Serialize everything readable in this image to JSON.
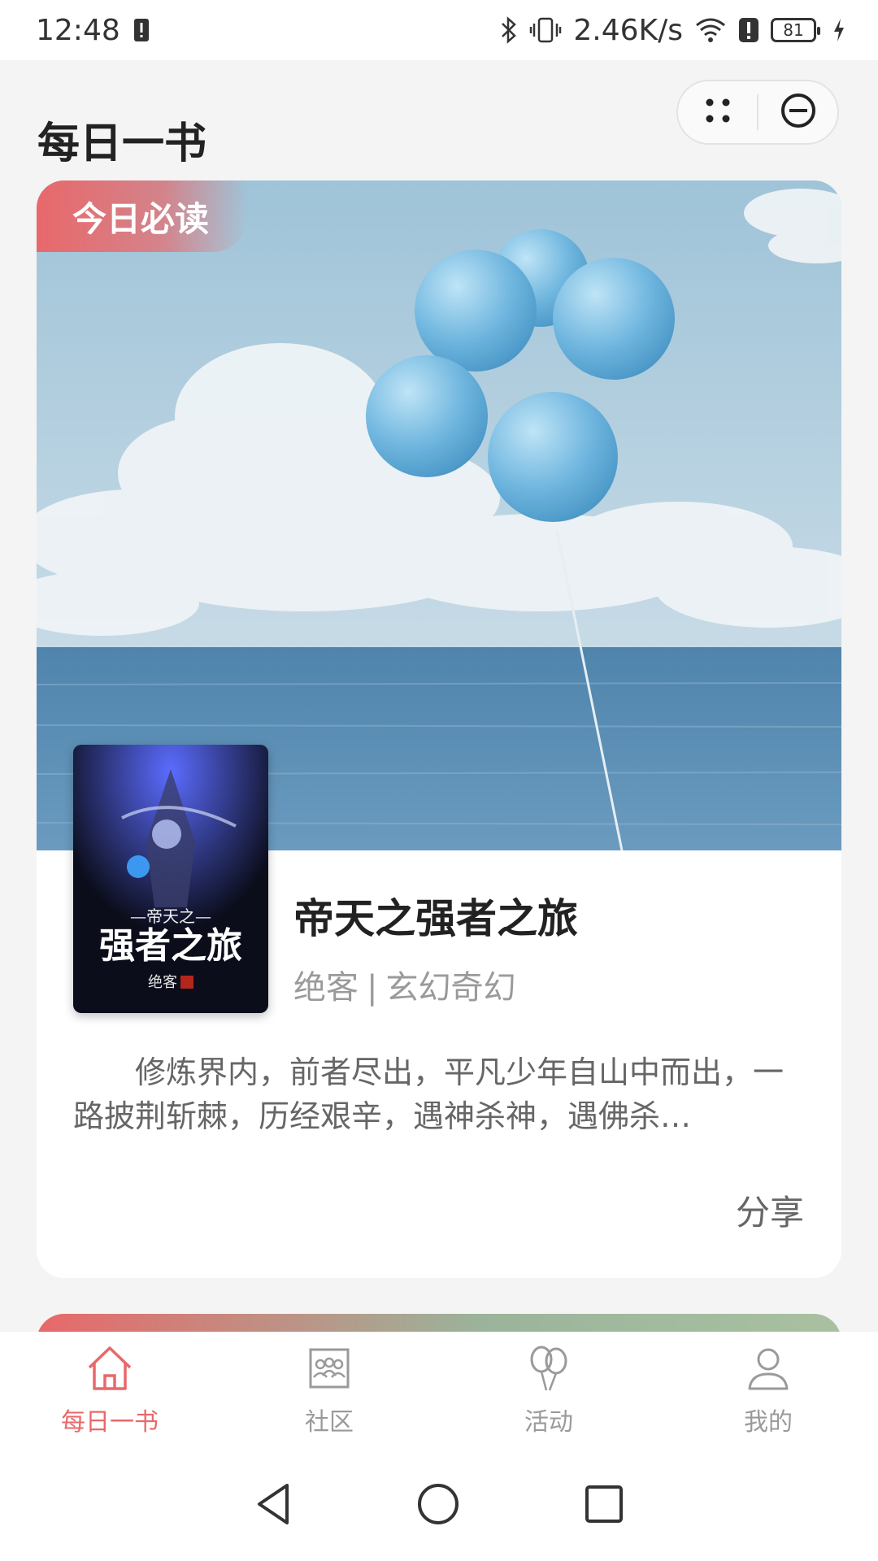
{
  "status_bar": {
    "time": "12:48",
    "network_speed": "2.46K/s",
    "battery_level": "81",
    "icons": [
      "sim-alert-icon",
      "bluetooth-icon",
      "vibrate-icon",
      "wifi-icon",
      "alert-icon",
      "battery-icon",
      "charging-icon"
    ]
  },
  "header": {
    "title": "每日一书",
    "capsule": {
      "menu_icon": "more-dots-icon",
      "close_icon": "minus-circle-icon"
    }
  },
  "card": {
    "badge": "今日必读",
    "book": {
      "title": "帝天之强者之旅",
      "author": "绝客",
      "separator": "|",
      "genre": "玄幻奇幻",
      "description": "修炼界内，前者尽出，平凡少年自山中而出，一路披荆斩棘，历经艰辛，遇神杀神，遇佛杀…",
      "cover_text": {
        "subtitle": "—帝天之—",
        "title": "强者之旅",
        "author": "绝客"
      }
    },
    "share_label": "分享"
  },
  "tabbar": {
    "tabs": [
      {
        "label": "每日一书",
        "icon": "home-icon",
        "active": true
      },
      {
        "label": "社区",
        "icon": "community-icon",
        "active": false
      },
      {
        "label": "活动",
        "icon": "balloons-icon",
        "active": false
      },
      {
        "label": "我的",
        "icon": "user-icon",
        "active": false
      }
    ]
  },
  "navbar": {
    "buttons": [
      "back-icon",
      "home-circle-icon",
      "recents-icon"
    ]
  },
  "colors": {
    "accent": "#e8686a",
    "inactive": "#9a9a9a",
    "background": "#f4f4f4"
  }
}
